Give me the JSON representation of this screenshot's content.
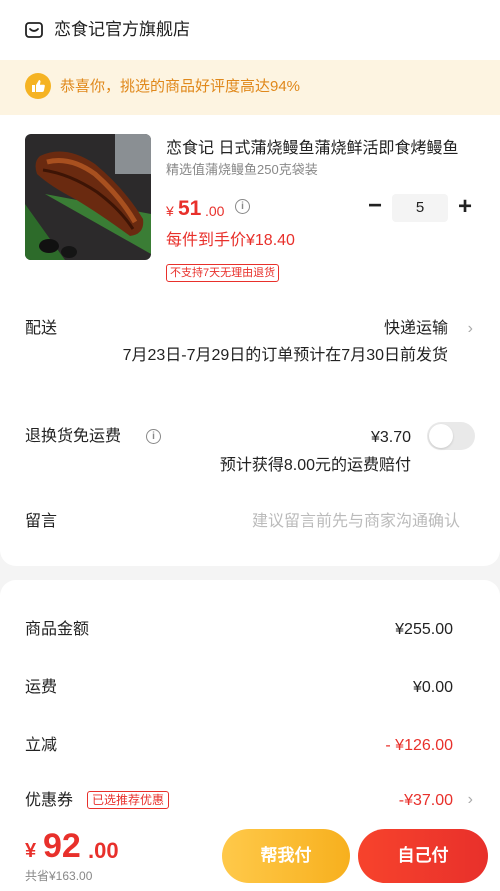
{
  "shop": {
    "name": "恋食记官方旗舰店",
    "icon": "shop-icon"
  },
  "banner": {
    "text": "恭喜你，挑选的商品好评度高达94%",
    "icon": "thumbs-up-icon",
    "accent": "#f5b323"
  },
  "product": {
    "title": "恋食记 日式蒲烧鳗鱼蒲烧鲜活即食烤鳗鱼",
    "spec": "精选值蒲烧鳗鱼250克袋装",
    "price_symbol": "¥",
    "price_int": "51",
    "price_dec": ".00",
    "per_item_price": "每件到手价¥18.40",
    "quantity": "5",
    "minus_label": "−",
    "plus_label": "+",
    "no_return_tag": "不支持7天无理由退货"
  },
  "delivery": {
    "label": "配送",
    "method": "快递运输",
    "note": "7月23日-7月29日的订单预计在7月30日前发货"
  },
  "return_shipping": {
    "label": "退换货免运费",
    "price": "¥3.70",
    "note": "预计获得8.00元的运费赔付",
    "enabled": false
  },
  "message": {
    "label": "留言",
    "placeholder": "建议留言前先与商家沟通确认"
  },
  "summary": {
    "goods_label": "商品金额",
    "goods_value": "¥255.00",
    "shipping_label": "运费",
    "shipping_value": "¥0.00",
    "discount_label": "立减",
    "discount_value": "- ¥126.00",
    "coupon_label": "优惠券",
    "coupon_badge": "已选推荐优惠",
    "coupon_value": "-¥37.00"
  },
  "footer": {
    "total_symbol": "¥",
    "total_int": "92",
    "total_dec": ".00",
    "saved": "共省¥163.00",
    "help_pay_label": "帮我付",
    "pay_label": "自己付"
  },
  "colors": {
    "price_red": "#e8302b",
    "banner_bg": "#fdf4e1",
    "banner_text": "#e0881b"
  },
  "chevron_glyph": "›",
  "info_glyph": "i"
}
